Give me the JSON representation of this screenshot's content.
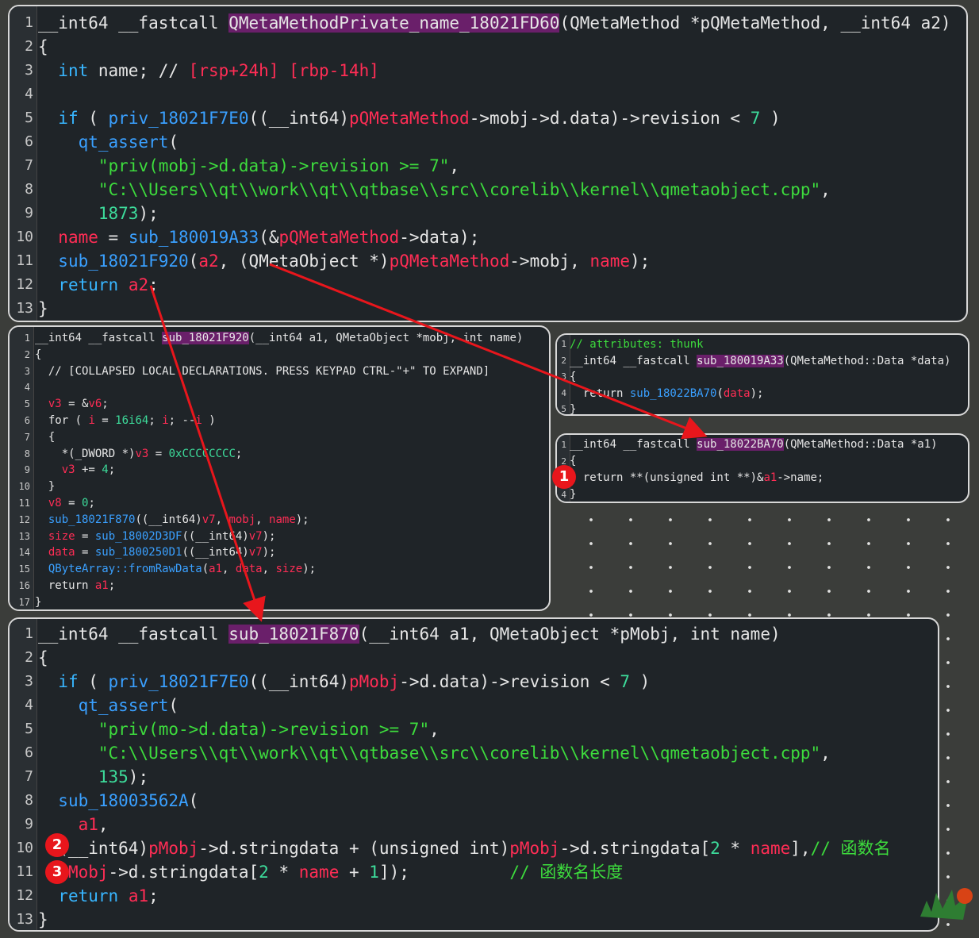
{
  "top_panel": {
    "lines": [
      {
        "n": "1",
        "parts": [
          [
            "wt",
            "__int64 __fastcall "
          ],
          [
            "hl",
            "QMetaMethodPrivate_name_18021FD60"
          ],
          [
            "wt",
            "(QMetaMethod *pQMetaMethod, __int64 a2)"
          ]
        ]
      },
      {
        "n": "2",
        "parts": [
          [
            "wt",
            "{"
          ]
        ]
      },
      {
        "n": "3",
        "parts": [
          [
            "wt",
            "  "
          ],
          [
            "kw",
            "int"
          ],
          [
            "wt",
            " name; // "
          ],
          [
            "rd",
            "[rsp+24h] [rbp-14h]"
          ]
        ]
      },
      {
        "n": "4",
        "parts": []
      },
      {
        "n": "5",
        "parts": [
          [
            "wt",
            "  "
          ],
          [
            "kw",
            "if"
          ],
          [
            "wt",
            " ( "
          ],
          [
            "fn",
            "priv_18021F7E0"
          ],
          [
            "wt",
            "((__int64)"
          ],
          [
            "rd",
            "pQMetaMethod"
          ],
          [
            "wt",
            "->mobj->d.data)->revision < "
          ],
          [
            "nm",
            "7"
          ],
          [
            "wt",
            " )"
          ]
        ]
      },
      {
        "n": "6",
        "parts": [
          [
            "wt",
            "    "
          ],
          [
            "fn",
            "qt_assert"
          ],
          [
            "wt",
            "("
          ]
        ]
      },
      {
        "n": "7",
        "parts": [
          [
            "wt",
            "      "
          ],
          [
            "st",
            "\"priv(mobj->d.data)->revision >= 7\""
          ],
          [
            "wt",
            ","
          ]
        ]
      },
      {
        "n": "8",
        "parts": [
          [
            "wt",
            "      "
          ],
          [
            "st",
            "\"C:\\\\Users\\\\qt\\\\work\\\\qt\\\\qtbase\\\\src\\\\corelib\\\\kernel\\\\qmetaobject.cpp\""
          ],
          [
            "wt",
            ","
          ]
        ]
      },
      {
        "n": "9",
        "parts": [
          [
            "wt",
            "      "
          ],
          [
            "nm",
            "1873"
          ],
          [
            "wt",
            ");"
          ]
        ]
      },
      {
        "n": "10",
        "parts": [
          [
            "wt",
            "  "
          ],
          [
            "rd",
            "name"
          ],
          [
            "wt",
            " = "
          ],
          [
            "fn",
            "sub_180019A33"
          ],
          [
            "wt",
            "(&"
          ],
          [
            "rd",
            "pQMetaMethod"
          ],
          [
            "wt",
            "->data);"
          ]
        ]
      },
      {
        "n": "11",
        "parts": [
          [
            "wt",
            "  "
          ],
          [
            "fn",
            "sub_18021F920"
          ],
          [
            "wt",
            "("
          ],
          [
            "rd",
            "a2"
          ],
          [
            "wt",
            ", (QMetaObject *)"
          ],
          [
            "rd",
            "pQMetaMethod"
          ],
          [
            "wt",
            "->mobj, "
          ],
          [
            "rd",
            "name"
          ],
          [
            "wt",
            ");"
          ]
        ]
      },
      {
        "n": "12",
        "parts": [
          [
            "wt",
            "  "
          ],
          [
            "kw",
            "return"
          ],
          [
            "wt",
            " "
          ],
          [
            "rd",
            "a2"
          ],
          [
            "wt",
            ";"
          ]
        ]
      },
      {
        "n": "13",
        "parts": [
          [
            "wt",
            "}"
          ]
        ]
      }
    ]
  },
  "mid_left_panel": {
    "lines": [
      {
        "n": "1",
        "parts": [
          [
            "wt",
            "__int64 __fastcall "
          ],
          [
            "hl",
            "sub_18021F920"
          ],
          [
            "wt",
            "(__int64 a1, QMetaObject *mobj, int name)"
          ]
        ]
      },
      {
        "n": "2",
        "parts": [
          [
            "wt",
            "{"
          ]
        ]
      },
      {
        "n": "3",
        "parts": [
          [
            "wt",
            "  // [COLLAPSED LOCAL DECLARATIONS. PRESS KEYPAD CTRL-\"+\" TO EXPAND]"
          ]
        ]
      },
      {
        "n": "4",
        "parts": []
      },
      {
        "n": "5",
        "parts": [
          [
            "wt",
            "  "
          ],
          [
            "rd",
            "v3"
          ],
          [
            "wt",
            " = &"
          ],
          [
            "rd",
            "v6"
          ],
          [
            "wt",
            ";"
          ]
        ]
      },
      {
        "n": "6",
        "parts": [
          [
            "wt",
            "  for ( "
          ],
          [
            "rd",
            "i"
          ],
          [
            "wt",
            " = "
          ],
          [
            "nm",
            "16i64"
          ],
          [
            "wt",
            "; "
          ],
          [
            "rd",
            "i"
          ],
          [
            "wt",
            "; --"
          ],
          [
            "rd",
            "i"
          ],
          [
            "wt",
            " )"
          ]
        ]
      },
      {
        "n": "7",
        "parts": [
          [
            "wt",
            "  {"
          ]
        ]
      },
      {
        "n": "8",
        "parts": [
          [
            "wt",
            "    *(_DWORD *)"
          ],
          [
            "rd",
            "v3"
          ],
          [
            "wt",
            " = "
          ],
          [
            "nm",
            "0xCCCCCCCC"
          ],
          [
            "wt",
            ";"
          ]
        ]
      },
      {
        "n": "9",
        "parts": [
          [
            "wt",
            "    "
          ],
          [
            "rd",
            "v3"
          ],
          [
            "wt",
            " += "
          ],
          [
            "nm",
            "4"
          ],
          [
            "wt",
            ";"
          ]
        ]
      },
      {
        "n": "10",
        "parts": [
          [
            "wt",
            "  }"
          ]
        ]
      },
      {
        "n": "11",
        "parts": [
          [
            "wt",
            "  "
          ],
          [
            "rd",
            "v8"
          ],
          [
            "wt",
            " = "
          ],
          [
            "nm",
            "0"
          ],
          [
            "wt",
            ";"
          ]
        ]
      },
      {
        "n": "12",
        "parts": [
          [
            "wt",
            "  "
          ],
          [
            "fn",
            "sub_18021F870"
          ],
          [
            "wt",
            "((__int64)"
          ],
          [
            "rd",
            "v7"
          ],
          [
            "wt",
            ", "
          ],
          [
            "rd",
            "mobj"
          ],
          [
            "wt",
            ", "
          ],
          [
            "rd",
            "name"
          ],
          [
            "wt",
            ");"
          ]
        ]
      },
      {
        "n": "13",
        "parts": [
          [
            "wt",
            "  "
          ],
          [
            "rd",
            "size"
          ],
          [
            "wt",
            " = "
          ],
          [
            "fn",
            "sub_18002D3DF"
          ],
          [
            "wt",
            "((__int64)"
          ],
          [
            "rd",
            "v7"
          ],
          [
            "wt",
            ");"
          ]
        ]
      },
      {
        "n": "14",
        "parts": [
          [
            "wt",
            "  "
          ],
          [
            "rd",
            "data"
          ],
          [
            "wt",
            " = "
          ],
          [
            "fn",
            "sub_1800250D1"
          ],
          [
            "wt",
            "((__int64)"
          ],
          [
            "rd",
            "v7"
          ],
          [
            "wt",
            ");"
          ]
        ]
      },
      {
        "n": "15",
        "parts": [
          [
            "wt",
            "  "
          ],
          [
            "fn",
            "QByteArray::fromRawData"
          ],
          [
            "wt",
            "("
          ],
          [
            "rd",
            "a1"
          ],
          [
            "wt",
            ", "
          ],
          [
            "rd",
            "data"
          ],
          [
            "wt",
            ", "
          ],
          [
            "rd",
            "size"
          ],
          [
            "wt",
            ");"
          ]
        ]
      },
      {
        "n": "16",
        "parts": [
          [
            "wt",
            "  return "
          ],
          [
            "rd",
            "a1"
          ],
          [
            "wt",
            ";"
          ]
        ]
      },
      {
        "n": "17",
        "parts": [
          [
            "wt",
            "}"
          ]
        ]
      }
    ]
  },
  "mid_right_top_panel": {
    "lines": [
      {
        "n": "1",
        "parts": [
          [
            "cmgn",
            "// attributes: thunk"
          ]
        ]
      },
      {
        "n": "2",
        "parts": [
          [
            "wt",
            "__int64 __fastcall "
          ],
          [
            "hl",
            "sub_180019A33"
          ],
          [
            "wt",
            "(QMetaMethod::Data *data)"
          ]
        ]
      },
      {
        "n": "3",
        "parts": [
          [
            "wt",
            "{"
          ]
        ]
      },
      {
        "n": "4",
        "parts": [
          [
            "wt",
            "  return "
          ],
          [
            "fn",
            "sub_18022BA70"
          ],
          [
            "wt",
            "("
          ],
          [
            "rd",
            "data"
          ],
          [
            "wt",
            ");"
          ]
        ]
      },
      {
        "n": "5",
        "parts": [
          [
            "wt",
            "}"
          ]
        ]
      }
    ]
  },
  "mid_right_bottom_panel": {
    "lines": [
      {
        "n": "1",
        "parts": [
          [
            "wt",
            "__int64 __fastcall "
          ],
          [
            "hl",
            "sub_18022BA70"
          ],
          [
            "wt",
            "(QMetaMethod::Data *a1)"
          ]
        ]
      },
      {
        "n": "2",
        "parts": [
          [
            "wt",
            "{"
          ]
        ]
      },
      {
        "n": "3",
        "parts": [
          [
            "wt",
            "  return **(unsigned int **)&"
          ],
          [
            "rd",
            "a1"
          ],
          [
            "wt",
            "->name;"
          ]
        ]
      },
      {
        "n": "4",
        "parts": [
          [
            "wt",
            "}"
          ]
        ]
      }
    ]
  },
  "bottom_panel": {
    "lines": [
      {
        "n": "1",
        "parts": [
          [
            "wt",
            "__int64 __fastcall "
          ],
          [
            "hl",
            "sub_18021F870"
          ],
          [
            "wt",
            "(__int64 a1, QMetaObject *pMobj, int name)"
          ]
        ]
      },
      {
        "n": "2",
        "parts": [
          [
            "wt",
            "{"
          ]
        ]
      },
      {
        "n": "3",
        "parts": [
          [
            "wt",
            "  "
          ],
          [
            "kw",
            "if"
          ],
          [
            "wt",
            " ( "
          ],
          [
            "fn",
            "priv_18021F7E0"
          ],
          [
            "wt",
            "((__int64)"
          ],
          [
            "rd",
            "pMobj"
          ],
          [
            "wt",
            "->d.data)->revision < "
          ],
          [
            "nm",
            "7"
          ],
          [
            "wt",
            " )"
          ]
        ]
      },
      {
        "n": "4",
        "parts": [
          [
            "wt",
            "    "
          ],
          [
            "fn",
            "qt_assert"
          ],
          [
            "wt",
            "("
          ]
        ]
      },
      {
        "n": "5",
        "parts": [
          [
            "wt",
            "      "
          ],
          [
            "st",
            "\"priv(mo->d.data)->revision >= 7\""
          ],
          [
            "wt",
            ","
          ]
        ]
      },
      {
        "n": "6",
        "parts": [
          [
            "wt",
            "      "
          ],
          [
            "st",
            "\"C:\\\\Users\\\\qt\\\\work\\\\qt\\\\qtbase\\\\src\\\\corelib\\\\kernel\\\\qmetaobject.cpp\""
          ],
          [
            "wt",
            ","
          ]
        ]
      },
      {
        "n": "7",
        "parts": [
          [
            "wt",
            "      "
          ],
          [
            "nm",
            "135"
          ],
          [
            "wt",
            ");"
          ]
        ]
      },
      {
        "n": "8",
        "parts": [
          [
            "wt",
            "  "
          ],
          [
            "fn",
            "sub_18003562A"
          ],
          [
            "wt",
            "("
          ]
        ]
      },
      {
        "n": "9",
        "parts": [
          [
            "wt",
            "    "
          ],
          [
            "rd",
            "a1"
          ],
          [
            "wt",
            ","
          ]
        ]
      },
      {
        "n": "10",
        "parts": [
          [
            "wt",
            "  (__int64)"
          ],
          [
            "rd",
            "pMobj"
          ],
          [
            "wt",
            "->d.stringdata + (unsigned int)"
          ],
          [
            "rd",
            "pMobj"
          ],
          [
            "wt",
            "->d.stringdata["
          ],
          [
            "nm",
            "2"
          ],
          [
            "wt",
            " * "
          ],
          [
            "rd",
            "name"
          ],
          [
            "wt",
            "],"
          ],
          [
            "cmgn",
            "// 函数名"
          ]
        ]
      },
      {
        "n": "11",
        "parts": [
          [
            "wt",
            "  "
          ],
          [
            "rd",
            "pMobj"
          ],
          [
            "wt",
            "->d.stringdata["
          ],
          [
            "nm",
            "2"
          ],
          [
            "wt",
            " * "
          ],
          [
            "rd",
            "name"
          ],
          [
            "wt",
            " + "
          ],
          [
            "nm",
            "1"
          ],
          [
            "wt",
            "]);          "
          ],
          [
            "cmgn",
            "// 函数名长度"
          ]
        ]
      },
      {
        "n": "12",
        "parts": [
          [
            "wt",
            "  "
          ],
          [
            "kw",
            "return"
          ],
          [
            "wt",
            " "
          ],
          [
            "rd",
            "a1"
          ],
          [
            "wt",
            ";"
          ]
        ]
      },
      {
        "n": "13",
        "parts": [
          [
            "wt",
            "}"
          ]
        ]
      }
    ]
  },
  "badges": [
    "1",
    "2",
    "3"
  ],
  "colors": {
    "arrow": "#e8161c",
    "badge": "#e8161c",
    "highlight": "#6a1f6a"
  }
}
